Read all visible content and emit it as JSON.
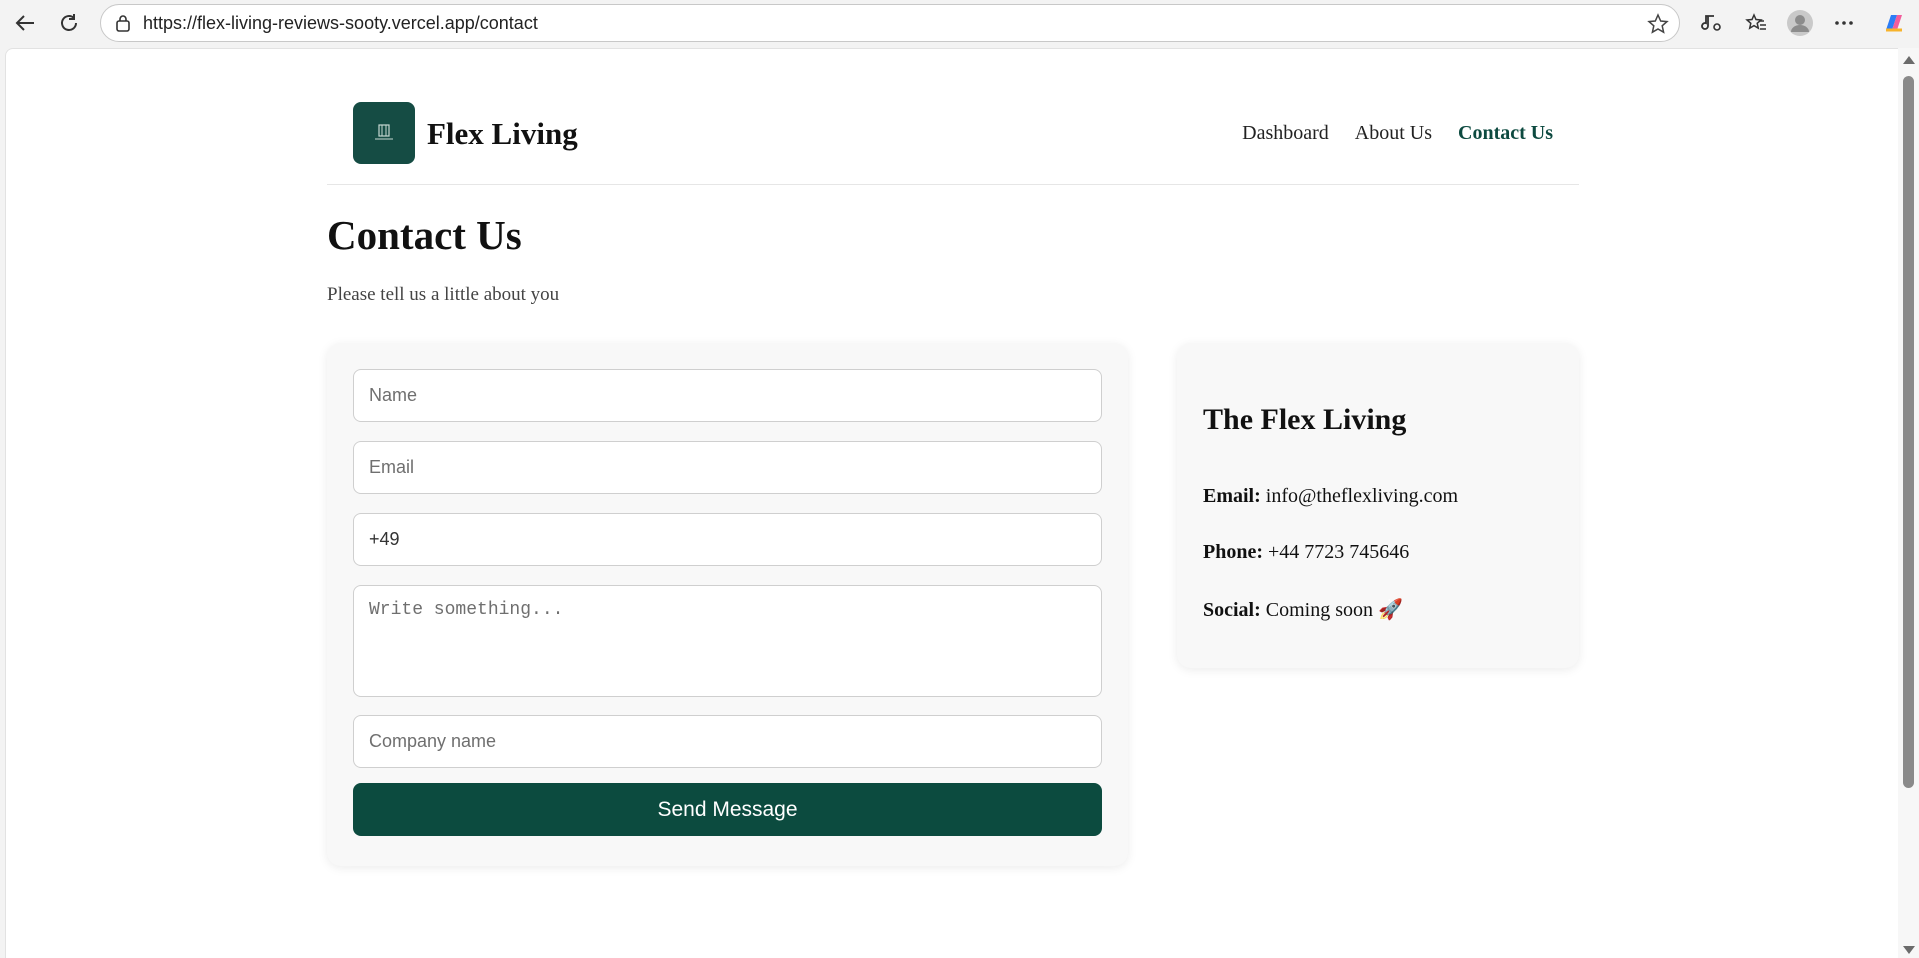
{
  "browser": {
    "url": "https://flex-living-reviews-sooty.vercel.app/contact"
  },
  "header": {
    "brand": "Flex Living",
    "nav": [
      {
        "label": "Dashboard",
        "active": false
      },
      {
        "label": "About Us",
        "active": false
      },
      {
        "label": "Contact Us",
        "active": true
      }
    ]
  },
  "page": {
    "title": "Contact Us",
    "subtitle": "Please tell us a little about you"
  },
  "form": {
    "name_placeholder": "Name",
    "email_placeholder": "Email",
    "phone_value": "+49",
    "message_placeholder": "Write something...",
    "company_placeholder": "Company name",
    "submit_label": "Send Message"
  },
  "info": {
    "title": "The Flex Living",
    "email_label": "Email:",
    "email_value": "info@theflexliving.com",
    "phone_label": "Phone:",
    "phone_value": "+44 7723 745646",
    "social_label": "Social:",
    "social_value": "Coming soon 🚀"
  },
  "colors": {
    "brand": "#154c44",
    "accent": "#0c4b3f"
  }
}
